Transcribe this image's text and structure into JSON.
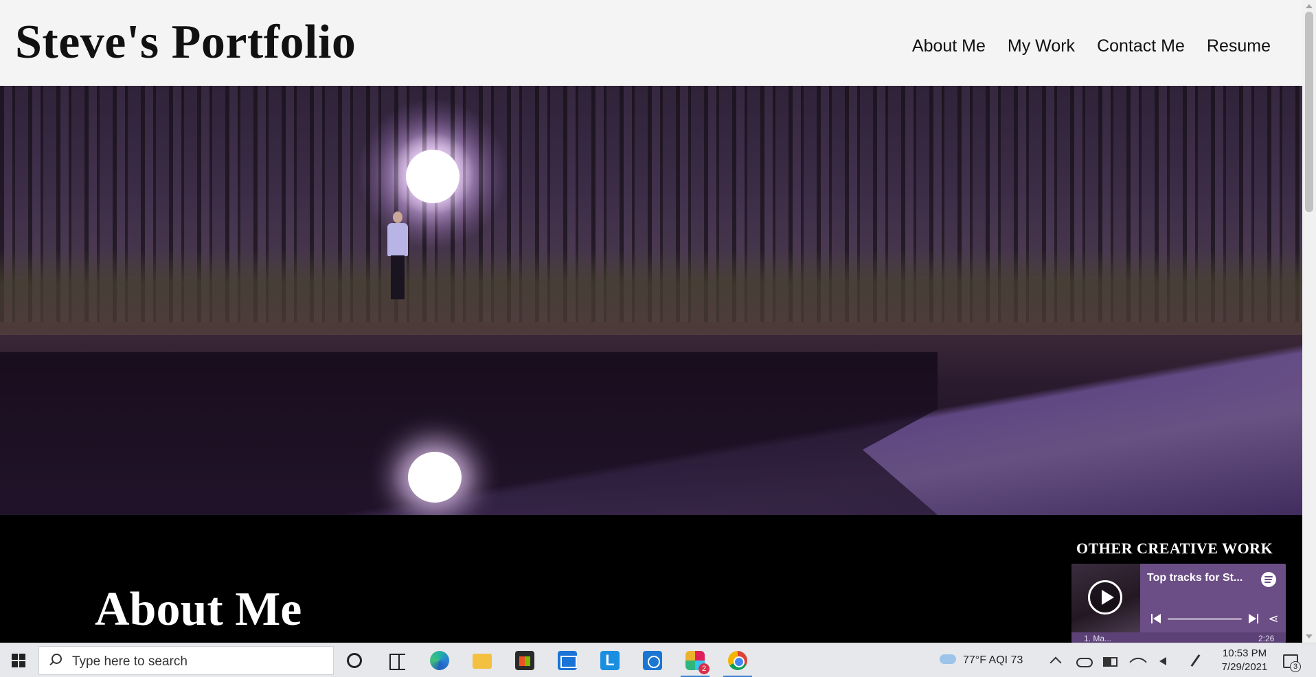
{
  "site": {
    "title": "Steve's Portfolio",
    "nav": [
      "About Me",
      "My Work",
      "Contact Me",
      "Resume"
    ]
  },
  "about": {
    "heading": "About Me",
    "other_work_heading": "OTHER CREATIVE WORK"
  },
  "spotify": {
    "title": "Top tracks for St...",
    "track_row_left": "1. Ma...",
    "track_row_right": "2:26"
  },
  "taskbar": {
    "search_placeholder": "Type here to search",
    "slack_badge": "2",
    "weather": "77°F  AQI 73",
    "time": "10:53 PM",
    "date": "7/29/2021",
    "notifications_count": "3"
  },
  "colors": {
    "header_bg": "#f4f4f4",
    "spotify_bg": "#6c4e86",
    "page_bg": "#000000"
  }
}
